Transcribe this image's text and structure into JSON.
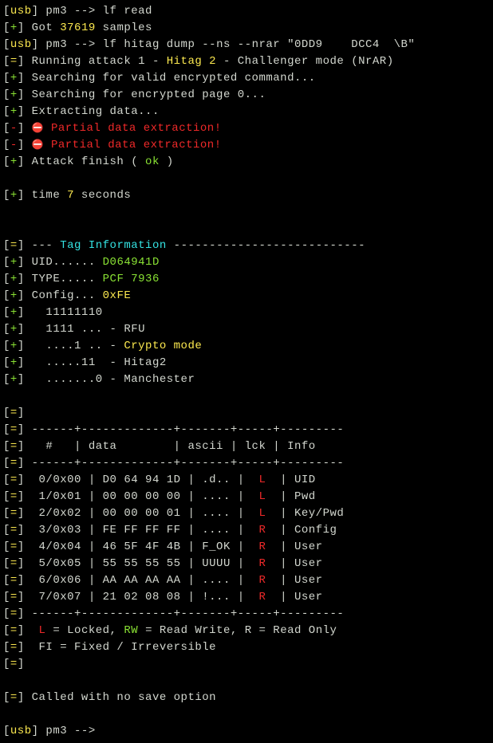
{
  "lines": {
    "l1_usb": "usb",
    "l1_pm3": "] pm3 --> ",
    "l1_cmd": "lf read",
    "l2_plus": "+",
    "l2_got": "] Got ",
    "l2_samples": "37619",
    "l2_samples_txt": " samples",
    "l3_usb": "usb",
    "l3_pm3": "] pm3 --> ",
    "l3_cmd": "lf hitag dump --ns --nrar \"0DD9    DCC4  \\B\"",
    "l4_eq": "=",
    "l4_txt": "] Running attack 1 - ",
    "l4_hitag": "Hitag 2",
    "l4_rest": " - Challenger mode (NrAR)",
    "l5_plus": "+",
    "l5_txt": "] Searching for valid encrypted command...",
    "l6_plus": "+",
    "l6_txt": "] Searching for encrypted page 0...",
    "l7_plus": "+",
    "l7_txt": "] Extracting data...",
    "l8_minus": "-",
    "l8_txt": " Partial data extraction!",
    "l9_minus": "-",
    "l9_txt": " Partial data extraction!",
    "l10_plus": "+",
    "l10_txt": "] Attack finish ( ",
    "l10_ok": "ok",
    "l10_end": " )",
    "l12_plus": "+",
    "l12_txt": "] time ",
    "l12_num": "7",
    "l12_sec": " seconds",
    "l15_eq": "=",
    "l15_dash1": "] --- ",
    "l15_tag": "Tag Information",
    "l15_dash2": " ---------------------------",
    "l16_plus": "+",
    "l16_label": "] UID...... ",
    "l16_val": "D064941D",
    "l17_plus": "+",
    "l17_label": "] TYPE..... ",
    "l17_val": "PCF 7936",
    "l18_plus": "+",
    "l18_label": "] Config... ",
    "l18_val": "0xFE",
    "l19_plus": "+",
    "l19_txt": "]   11111110",
    "l20_plus": "+",
    "l20_txt": "]   1111 ... - RFU",
    "l21_plus": "+",
    "l21_txt": "]   ....1 .. - ",
    "l21_crypto": "Crypto mode",
    "l22_plus": "+",
    "l22_txt": "]   .....11  - Hitag2",
    "l23_plus": "+",
    "l23_txt": "]   .......0 - Manchester",
    "l25_eq": "=",
    "l25_txt": "]",
    "l26_eq": "=",
    "l26_sep": "] ------+-------------+-------+-----+---------",
    "l27_eq": "=",
    "l27_hdr": "]   #   | data        | ascii | lck | Info",
    "l28_eq": "=",
    "l28_sep": "] ------+-------------+-------+-----+---------",
    "l29_eq": "=",
    "l29_r1": "]  0/0x00 | D0 64 94 1D | .d.. |  ",
    "l29_lck": "L",
    "l29_r2": "  | UID",
    "l30_eq": "=",
    "l30_r1": "]  1/0x01 | 00 00 00 00 | .... |  ",
    "l30_lck": "L",
    "l30_r2": "  | Pwd",
    "l31_eq": "=",
    "l31_r1": "]  2/0x02 | 00 00 00 01 | .... |  ",
    "l31_lck": "L",
    "l31_r2": "  | Key/Pwd",
    "l32_eq": "=",
    "l32_r1": "]  3/0x03 | FE FF FF FF | .... |  ",
    "l32_lck": "R",
    "l32_r2": "  | Config",
    "l33_eq": "=",
    "l33_r1": "]  4/0x04 | 46 5F 4F 4B | F_OK |  ",
    "l33_lck": "R",
    "l33_r2": "  | User",
    "l34_eq": "=",
    "l34_r1": "]  5/0x05 | 55 55 55 55 | UUUU |  ",
    "l34_lck": "R",
    "l34_r2": "  | User",
    "l35_eq": "=",
    "l35_r1": "]  6/0x06 | AA AA AA AA | .... |  ",
    "l35_lck": "R",
    "l35_r2": "  | User",
    "l36_eq": "=",
    "l36_r1": "]  7/0x07 | 21 02 08 08 | !... |  ",
    "l36_lck": "R",
    "l36_r2": "  | User",
    "l37_eq": "=",
    "l37_sep": "] ------+-------------+-------+-----+---------",
    "l38_eq": "=",
    "l38_txt1": "]  ",
    "l38_L": "L",
    "l38_txt2": " = Locked, ",
    "l38_RW": "RW",
    "l38_txt3": " = Read Write, R = Read Only",
    "l39_eq": "=",
    "l39_txt": "]  FI = Fixed / Irreversible",
    "l40_eq": "=",
    "l40_txt": "]",
    "l42_eq": "=",
    "l42_txt": "] Called with no save option",
    "l44_usb": "usb",
    "l44_pm3": "] pm3 --> "
  }
}
